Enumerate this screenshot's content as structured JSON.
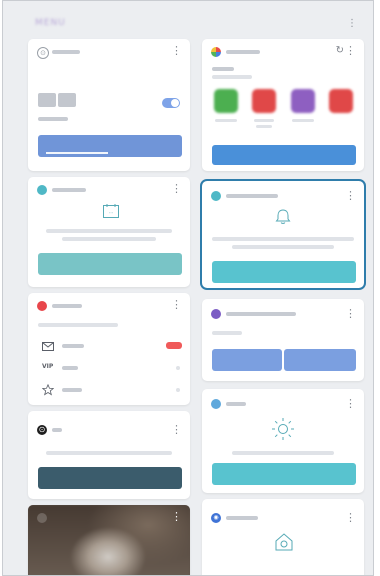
{
  "header": {
    "app_label": "MENU",
    "more": "⋮"
  },
  "cards": {
    "switch": {
      "toggle_on": true,
      "more": "⋮"
    },
    "apps": {
      "more": "⋮",
      "refresh": "↻",
      "tiles": [
        {
          "color": "#4caf50"
        },
        {
          "color": "#e04848"
        },
        {
          "color": "#8e5fc1"
        },
        {
          "color": "#e04848"
        }
      ]
    },
    "calendar": {
      "more": "⋮"
    },
    "reminder": {
      "more": "⋮"
    },
    "email": {
      "more": "⋮",
      "rows": [
        {
          "icon": "envelope-icon",
          "badge": true
        },
        {
          "label": "VIP"
        },
        {
          "icon": "star-icon"
        }
      ]
    },
    "samsung_notes": {
      "more": "⋮"
    },
    "news": {
      "more": "⋮"
    },
    "weather": {
      "more": "⋮"
    },
    "photo": {
      "more": "⋮"
    },
    "smart_things": {
      "more": "⋮"
    }
  },
  "colors": {
    "blue": "#6f8ed8",
    "teal": "#58c3cf",
    "dark_teal": "#2d5560",
    "focus": "#2f7dab",
    "gray": "#c7cbd2"
  }
}
